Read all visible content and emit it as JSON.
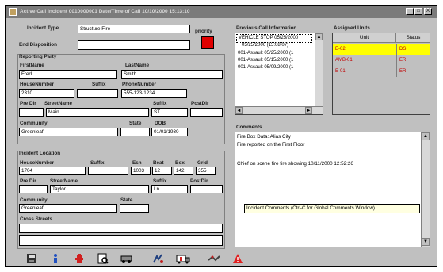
{
  "window": {
    "title": "Active Call Incident 0010000001   Date/Time of Call 10/10/2000 15:13:10",
    "buttons": [
      "_",
      "□",
      "X"
    ]
  },
  "incident": {
    "type_label": "Incident Type",
    "type_value": "Structure Fire",
    "priority_label": "priority",
    "end_disposition_label": "End Disposition",
    "end_disposition_value": ""
  },
  "reporting_party": {
    "section_label": "Reporting Party",
    "firstname_label": "FirstName",
    "firstname_value": "Fred",
    "lastname_label": "LastName",
    "lastname_value": "Smith",
    "housenumber_label": "HouseNumber",
    "housenumber_value": "2310",
    "suffix_label": "Suffix",
    "suffix_value": "",
    "phone_label": "PhoneNumber",
    "phone_value": "555-123-1234",
    "predir_label": "Pre Dir",
    "predir_value": "",
    "streetname_label": "StreetName",
    "streetname_value": "Main",
    "street_suffix_label": "Suffix",
    "street_suffix_value": "ST",
    "postdir_label": "PostDir",
    "postdir_value": "",
    "community_label": "Community",
    "community_value": "Greenleaf",
    "state_label": "State",
    "state_value": "",
    "dob_label": "DOB",
    "dob_value": "01/01/1930"
  },
  "incident_location": {
    "section_label": "Incident Location",
    "housenumber_label": "HouseNumber",
    "housenumber_value": "1704",
    "suffix_label": "Suffix",
    "suffix_value": "",
    "esn_label": "Esn",
    "esn_value": "1003",
    "beat_label": "Beat",
    "beat_value": "12",
    "box_label": "Box",
    "box_value": "142",
    "grid_label": "Grid",
    "grid_value": "355",
    "predir_label": "Pre Dir",
    "predir_value": "",
    "streetname_label": "StreetName",
    "streetname_value": "Taylor",
    "street_suffix_label": "Suffix",
    "street_suffix_value": "Ln",
    "postdir_label": "PostDir",
    "postdir_value": "",
    "community_label": "Community",
    "community_value": "Greenleaf",
    "state_label": "State",
    "state_value": "",
    "cross_streets_label": "Cross Streets",
    "cross_streets_value": ""
  },
  "previous_calls": {
    "label": "Previous Call Information",
    "items": [
      "VEHICLE STOP 05/25/2000",
      "05/25/2000 (15:08:07)",
      "001-Assault 05/25/2000 (1",
      "001-Assault 05/15/2000 (1",
      "001-Assault 05/09/2000 (1"
    ]
  },
  "assigned_units": {
    "label": "Assigned Units",
    "col_unit": "Unit",
    "col_status": "Status",
    "rows": [
      {
        "unit": "E-02",
        "status": "DS"
      },
      {
        "unit": "AMB-01",
        "status": "ER"
      },
      {
        "unit": "E-01",
        "status": "ER"
      }
    ]
  },
  "comments": {
    "label": "Comments",
    "lines": [
      "Fire Box Data: Alias City",
      "Fire reported on the First Floor",
      "",
      "Chief on scene fire fire showing 10/11/2000 12:52:26"
    ],
    "tooltip": "Incident Comments (Ctrl-C for Global Comments Window)"
  },
  "toolbar": {
    "icons": [
      "save-icon",
      "info-icon",
      "hydrant-icon",
      "preview-icon",
      "vehicle-icon",
      "dispatch-icon",
      "ambulance-icon",
      "map-icon",
      "alert-icon"
    ]
  },
  "colors": {
    "priority": "#e00000",
    "selected_unit_row": "#ffff00",
    "unit_text": "#c00000",
    "tooltip_bg": "#ffffe1"
  }
}
